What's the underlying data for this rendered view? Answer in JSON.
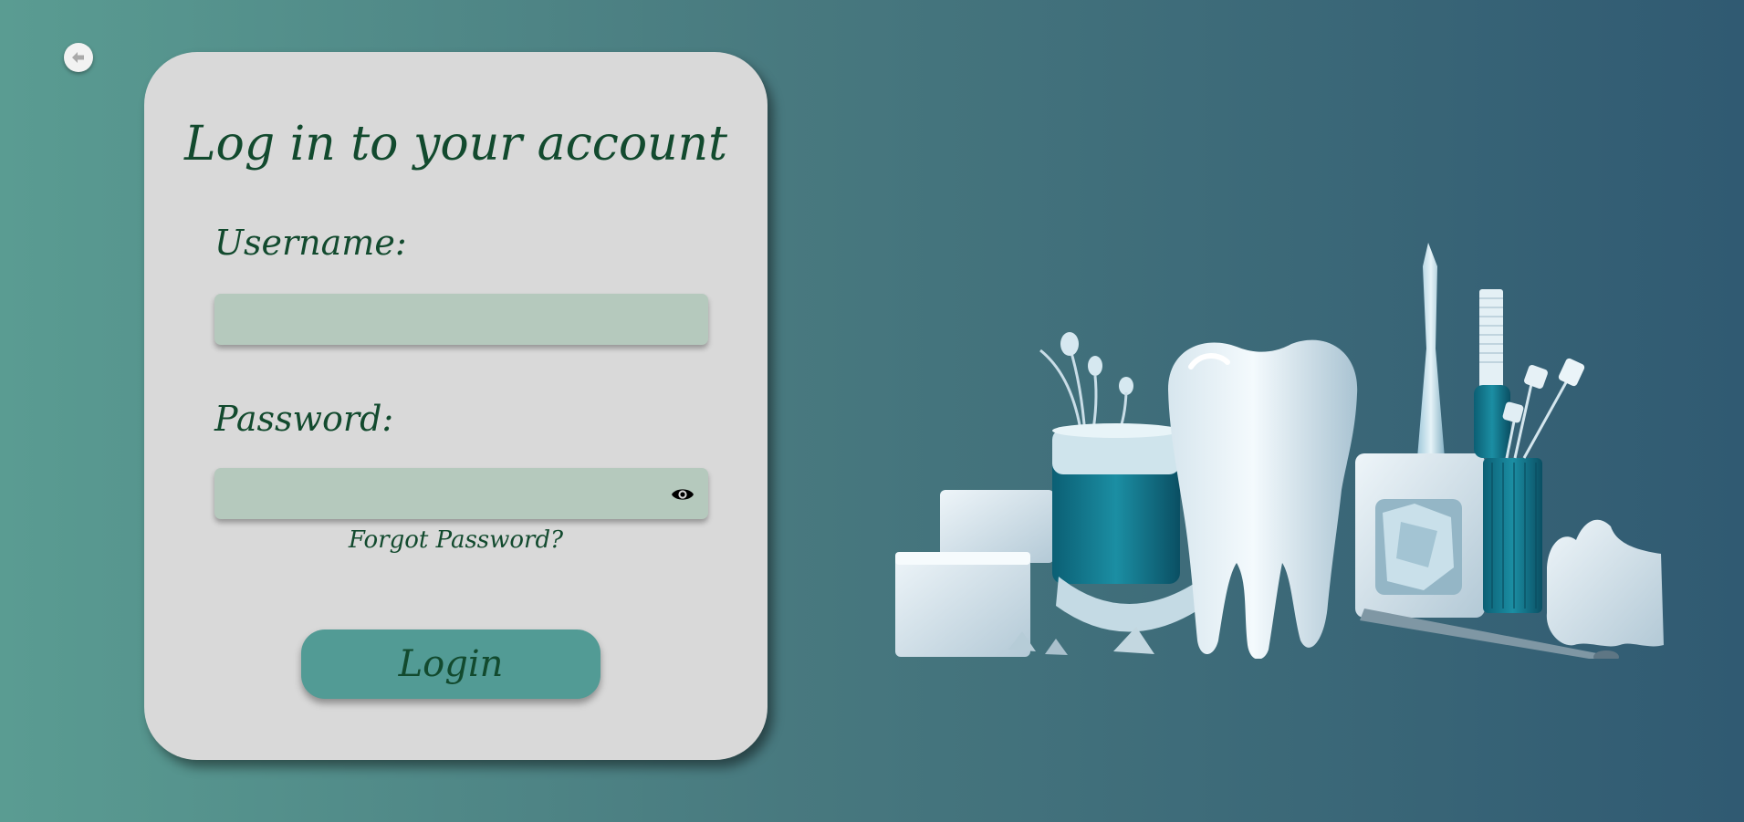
{
  "nav": {
    "back_icon": "arrow-left-icon"
  },
  "login": {
    "title": "Log in to your account",
    "username_label": "Username:",
    "username_value": "",
    "password_label": "Password:",
    "password_value": "",
    "password_toggle_icon": "eye-icon",
    "forgot_label": "Forgot Password?",
    "submit_label": "Login"
  },
  "illustration": {
    "subject": "dental-care-illustration"
  },
  "colors": {
    "card": "#d9d9d9",
    "text": "#124a2e",
    "field": "#b5c9bd",
    "button": "#529b95",
    "bg_left": "#5a9c92",
    "bg_right": "#305a72"
  }
}
